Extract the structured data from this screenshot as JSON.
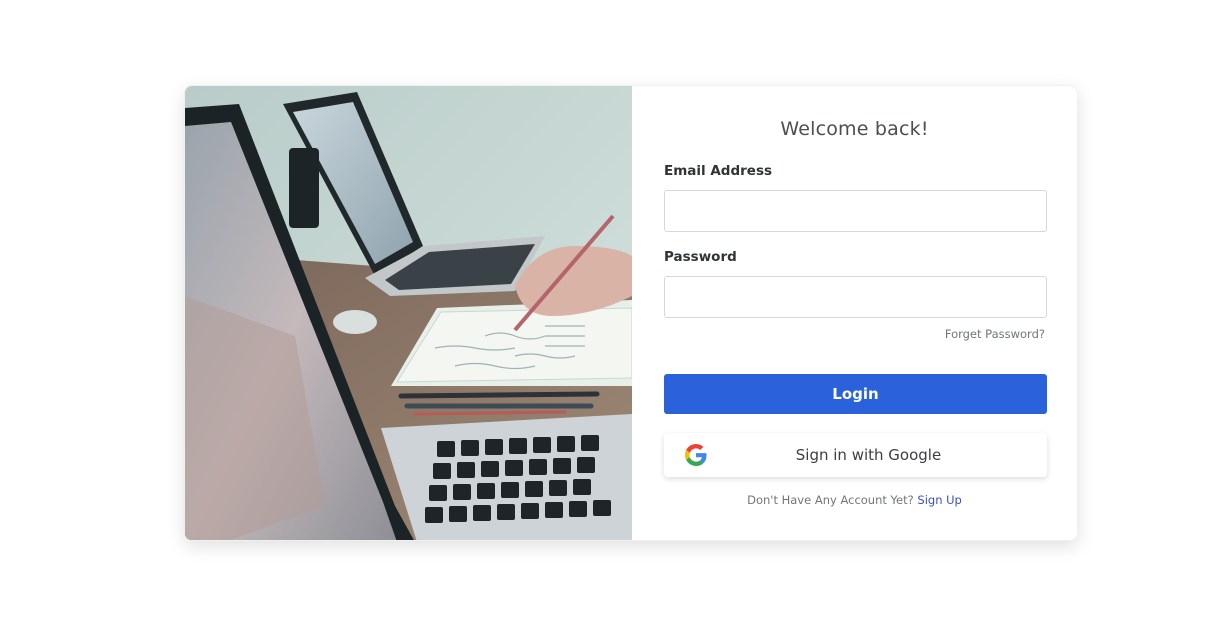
{
  "form": {
    "title": "Welcome back!",
    "email_label": "Email Address",
    "email_value": "",
    "email_placeholder": "",
    "password_label": "Password",
    "password_value": "",
    "password_placeholder": "",
    "forgot_link": "Forget Password?",
    "login_button": "Login",
    "google_button": "Sign in with Google",
    "signup_prompt": "Don't Have Any Account Yet?",
    "signup_link": "Sign Up"
  },
  "colors": {
    "primary": "#2b62db",
    "link": "#3a4fc4",
    "muted_text": "#6f777d"
  },
  "icons": {
    "google": "google-g-icon"
  }
}
